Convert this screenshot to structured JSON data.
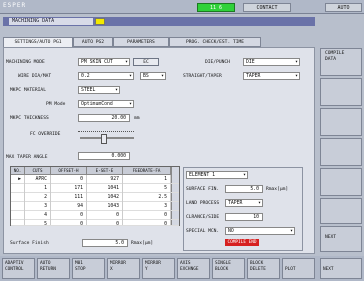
{
  "app_title": "ESPER",
  "topbar": {
    "indicator": "11 6",
    "contact": "CONTACT",
    "auto": "AUTO"
  },
  "window": {
    "title": "MACHINING DATA"
  },
  "tabs": [
    "SETTINGS/AUTO PG1",
    "AUTO PG2",
    "PARAMETERS",
    "PROG. CHECK/EST. TIME"
  ],
  "form": {
    "machining_mode_label": "MACHINING MODE",
    "machining_mode_value": "PM SKIN CUT",
    "ec_label": "EC",
    "wire_label": "WIRE DIA/MAT",
    "wire_dia": "0.2",
    "wire_mat": "BS",
    "mkpc_material_label": "MKPC MATERIAL",
    "mkpc_material_value": "STEEL",
    "pm_mode_label": "PM Mode",
    "pm_mode_value": "OptimumCond",
    "mkpc_thickness_label": "MKPC THICKNESS",
    "mkpc_thickness_value": "20.00",
    "mkpc_thickness_unit": "mm",
    "fc_override_label": "FC OVERRIDE",
    "max_taper_label": "MAX TAPER ANGLE",
    "max_taper_value": "0.000",
    "die_punch_label": "DIE/PUNCH",
    "die_punch_value": "DIE",
    "straight_taper_label": "STRAIGHT/TAPER",
    "straight_taper_value": "TAPER"
  },
  "table": {
    "headers": [
      "NO.",
      "CUTS",
      "OFFSET-H",
      "E-SET-E",
      "FEEDRATE-FA"
    ],
    "rows": [
      [
        "",
        "APRC",
        "0",
        "927",
        "1"
      ],
      [
        "",
        "1",
        "171",
        "1041",
        "5"
      ],
      [
        "",
        "2",
        "111",
        "1042",
        "2.5"
      ],
      [
        "",
        "3",
        "94",
        "1043",
        "3"
      ],
      [
        "",
        "4",
        "0",
        "0",
        "0"
      ],
      [
        "",
        "5",
        "0",
        "0",
        "0"
      ]
    ]
  },
  "surface_finish": {
    "label": "Surface Finish",
    "value": "5.0",
    "unit": "Rmax[μm]"
  },
  "element": {
    "element_value": "ELEMENT 1",
    "surface_fin_label": "SURFACE FIN.",
    "surface_fin_value": "5.0",
    "surface_fin_unit": "Rmax[μm]",
    "land_process_label": "LAND PROCESS",
    "land_process_value": "TAPER",
    "clrance_label": "CLRANCE/SIDE",
    "clrance_value": "10",
    "special_mcn_label": "SPECIAL MCN.",
    "special_mcn_value": "NO",
    "compile_end": "COMPILE END"
  },
  "side_buttons": [
    "COMPILE\nDATA",
    "",
    "",
    "",
    "",
    "",
    "NEXT"
  ],
  "function_keys": [
    "ADAPTIV\nCONTROL",
    "AUTO\nRETURN",
    "M01\nSTOP",
    "MIRROR\nX",
    "MIRROR\nY",
    "AXIS\nEXCHNGE",
    "SINGLE\nBLOCK",
    "BLOCK\nDELETE",
    "PLOT",
    "NEXT"
  ],
  "colors": {
    "title_bar": "#6a72a8",
    "indicator": "#2fd13a",
    "compile_end_bg": "#d62020",
    "yellow": "#f3e900"
  }
}
